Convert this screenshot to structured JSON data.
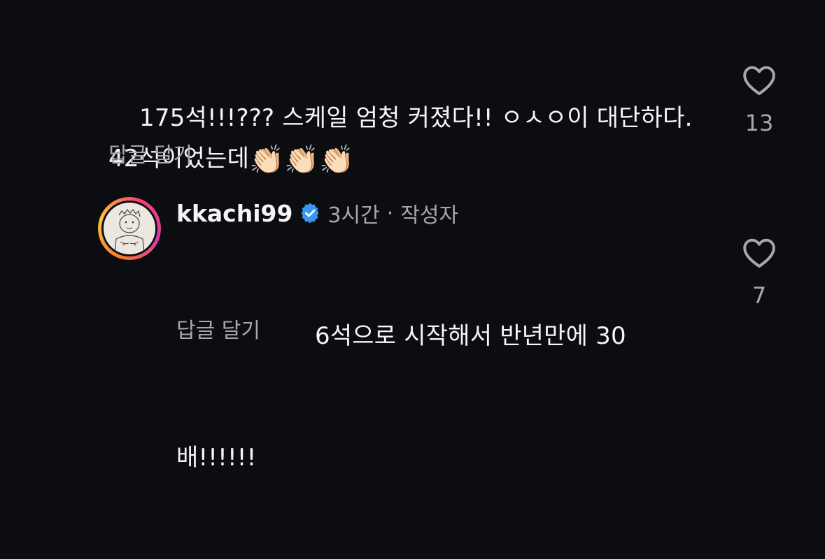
{
  "comments": [
    {
      "text": "175석!!!??? 스케일 엄청 커졌다!! ㅇㅅㅇ이 대단하다. 42석이었는데",
      "emoji": "👏🏻👏🏻👏🏻",
      "reply_label": "답글 달기",
      "likes": "13"
    },
    {
      "username": "kkachi99",
      "time": "3시간",
      "separator": "·",
      "role": "작성자",
      "text_line1": "6석으로 시작해서 반년만에 30",
      "text_line2": "배!!!!!!",
      "reply_label": "답글 달기",
      "likes": "7"
    }
  ],
  "colors": {
    "background": "#0c0d10",
    "primary_text": "#f3f5f7",
    "secondary_text": "#a8a8a8",
    "verified_badge": "#3897f0"
  },
  "icons": {
    "like": "heart-icon",
    "verified": "verified-badge-icon"
  }
}
